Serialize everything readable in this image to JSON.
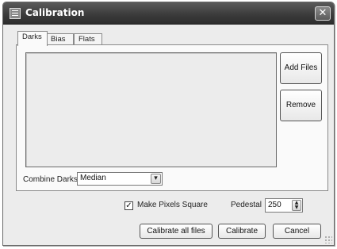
{
  "window": {
    "title": "Calibration",
    "icon": "calibration-app-icon",
    "close_icon": "close-icon",
    "close_glyph": "✕"
  },
  "tabs": [
    {
      "label": "Darks",
      "selected": true
    },
    {
      "label": "Bias",
      "selected": false
    },
    {
      "label": "Flats",
      "selected": false
    }
  ],
  "panel": {
    "file_list": [],
    "add_files_label": "Add Files",
    "remove_label": "Remove",
    "combine_label": "Combine Darks",
    "combine_value": "Median",
    "dropdown_glyph": "▾"
  },
  "options": {
    "make_square_label": "Make Pixels Square",
    "make_square_checked": true,
    "check_glyph": "✓",
    "pedestal_label": "Pedestal",
    "pedestal_value": "250",
    "spin_glyph": "▲\n▼"
  },
  "footer": {
    "calibrate_all_label": "Calibrate all files",
    "calibrate_label": "Calibrate",
    "cancel_label": "Cancel"
  }
}
